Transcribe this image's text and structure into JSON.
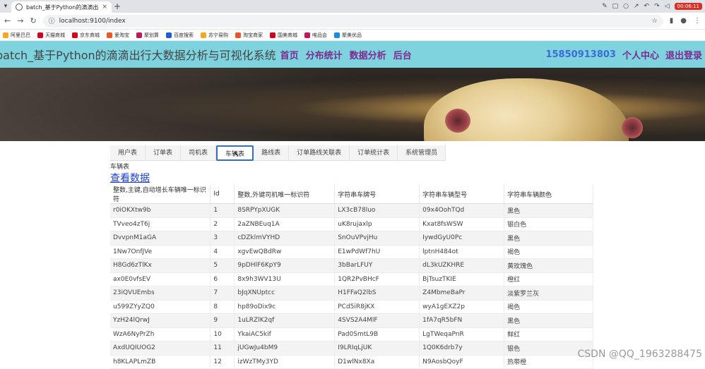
{
  "browser": {
    "tab_title": "batch_基于Python的滴滴出行",
    "tab_close": "×",
    "new_tab": "+",
    "url": "localhost:9100/index",
    "recording": "00:06:11",
    "bookmarks": [
      "阿里巴巴",
      "天猫商城",
      "京东商城",
      "爱淘宝",
      "聚划算",
      "百度搜索",
      "苏宁易购",
      "淘宝商家",
      "国美商城",
      "唯品会",
      "聚美优品"
    ],
    "bookmark_colors": [
      "#f5a623",
      "#d0021b",
      "#d0021b",
      "#e8562a",
      "#c2185b",
      "#1e5bd6",
      "#f5a623",
      "#e8562a",
      "#d0021b",
      "#c2185b",
      "#1e88e5"
    ]
  },
  "header": {
    "site_title": "batch_基于Python的滴滴出行大数据分析与可视化系统",
    "nav": [
      "首页",
      "分布统计",
      "数据分析",
      "后台"
    ],
    "phone": "15850913803",
    "profile": "个人中心",
    "logout": "退出登录"
  },
  "tabs": [
    "用户表",
    "订单表",
    "司机表",
    "车辆表",
    "路线表",
    "订单路线关联表",
    "订单统计表",
    "系统管理员"
  ],
  "active_tab_index": 3,
  "section_label": "车辆表",
  "view_link": "查看数据",
  "table": {
    "columns": [
      "整数,主键,自动增长车辆唯一标识符",
      "Id",
      "整数,外键司机唯一标识符",
      "字符串车牌号",
      "字符串车辆型号",
      "字符串车辆颜色"
    ],
    "rows": [
      [
        "r0iOKXtw9b",
        "1",
        "8SRPYpXUGK",
        "LX3cB78luo",
        "09x4OohTQd",
        "黑色"
      ],
      [
        "TVveo4zT6j",
        "2",
        "2aZNBEuq1A",
        "uK8rujaxlp",
        "Kxat8fsWSW",
        "银白色"
      ],
      [
        "DvvpnM1aGA",
        "3",
        "cDZklmVYHD",
        "SnOuVPvjHu",
        "IywdGyU0Pc",
        "黑色"
      ],
      [
        "1Nw7OnfJVe",
        "4",
        "xgvEwQBdRw",
        "E1wPdWf7hU",
        "lptnH484ot",
        "褐色"
      ],
      [
        "H8Gd6zTlKx",
        "5",
        "9pDHlF6KpY9",
        "3bBarLFUY",
        "dL3kUZKHRE",
        "黄玫瑰色"
      ],
      [
        "ax0E0vfsEV",
        "6",
        "8x9h3WV13U",
        "1QR2PvBHcF",
        "BjTsuzTKIE",
        "橙红"
      ],
      [
        "23iQVUEmbs",
        "7",
        "bJqXNUptcc",
        "H1FFaQ2lbS",
        "Z4MbmeBaPr",
        "淡紫罗兰灰"
      ],
      [
        "u599ZYyZQ0",
        "8",
        "hp89oDix9c",
        "PCd5iR8jKX",
        "wyA1gEXZ2p",
        "褐色"
      ],
      [
        "YzH24lQrwJ",
        "9",
        "1uLRZlK2qf",
        "4SVS2A4MlF",
        "1fA7qR5bFN",
        "黑色"
      ],
      [
        "WzA6NyPrZh",
        "10",
        "YkaiAC5kif",
        "Pad0SmtL9B",
        "LgTWeqaPnR",
        "鲜红"
      ],
      [
        "AxdUQIUOG2",
        "11",
        "jUGwJu4bM9",
        "I9LRIqLjUK",
        "1Q0K6drb7y",
        "银色"
      ],
      [
        "h8KLAPLmZB",
        "12",
        "izWzTMy3YD",
        "D1wlNx8Xa",
        "N9AosbQoyF",
        "热带橙"
      ]
    ]
  },
  "watermark": "CSDN @QQ_1963288475"
}
